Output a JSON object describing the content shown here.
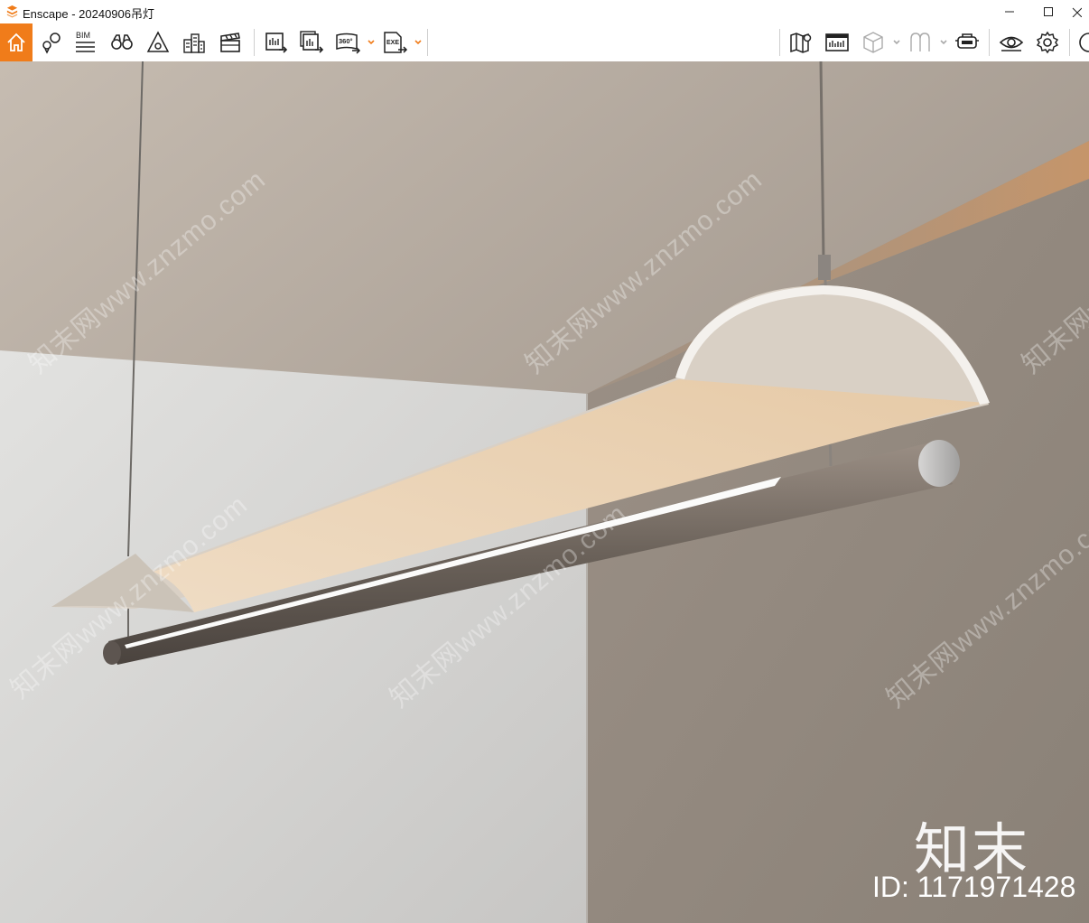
{
  "window": {
    "title": "Enscape - 20240906吊灯"
  },
  "toolbar": {
    "bim_label": "BIM",
    "panorama_label": "360°",
    "exe_label": "EXE",
    "icons": [
      "home-icon",
      "location-pin-icon",
      "bim-icon",
      "binoculars-icon",
      "perspective-icon",
      "buildings-icon",
      "clapperboard-icon",
      "screenshot-export-icon",
      "batch-render-icon",
      "panorama-360-icon",
      "exe-export-icon",
      "map-icon",
      "minimap-icon",
      "asset-cube-icon",
      "materials-icon",
      "vr-headset-icon",
      "visual-settings-icon",
      "settings-gear-icon"
    ],
    "accent_color": "#f07c1a"
  },
  "viewport": {
    "watermark_text": "知末网www.znzmo.com",
    "brand_logo_text": "知末",
    "brand_id": "ID: 1171971428"
  }
}
